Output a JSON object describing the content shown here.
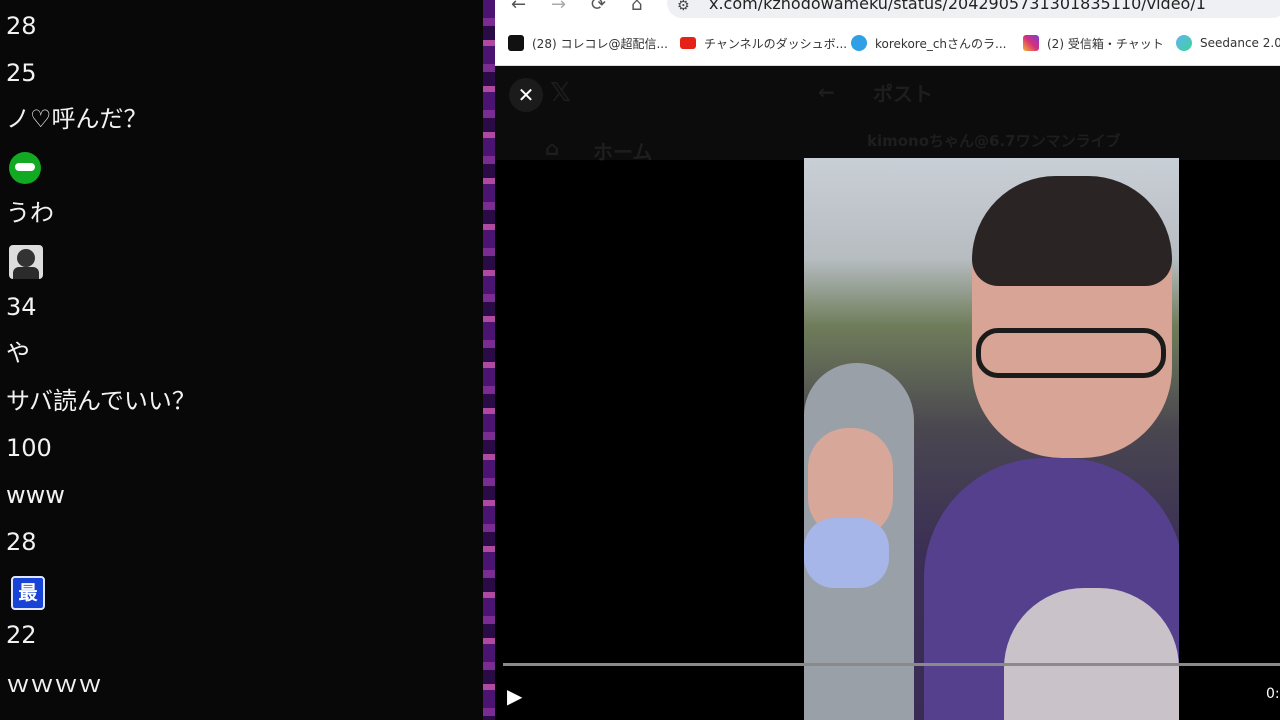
{
  "comments": {
    "items": [
      {
        "kind": "text",
        "text": "28"
      },
      {
        "kind": "text",
        "text": "25"
      },
      {
        "kind": "text",
        "text": "ノ♡呼んだ？"
      },
      {
        "kind": "stamp",
        "icon": "green-emoji-stamp"
      },
      {
        "kind": "text",
        "text": "うわ"
      },
      {
        "kind": "stamp",
        "icon": "avatar-stamp"
      },
      {
        "kind": "text",
        "text": "34"
      },
      {
        "kind": "text",
        "text": "や"
      },
      {
        "kind": "text",
        "text": "サバ読んでいい？"
      },
      {
        "kind": "text",
        "text": "100"
      },
      {
        "kind": "text",
        "text": "www"
      },
      {
        "kind": "text",
        "text": "28"
      },
      {
        "kind": "stamp",
        "icon": "blue-kanji-stamp",
        "text": "最"
      },
      {
        "kind": "text",
        "text": "22"
      },
      {
        "kind": "text",
        "text": "ｗｗｗｗ"
      }
    ]
  },
  "browser": {
    "url": "x.com/kzhodowameku/status/2042905731301835110/video/1",
    "nav": {
      "back": "←",
      "forward": "→",
      "reload": "⟳",
      "home": "⌂"
    },
    "bookmarks": [
      {
        "label": "(28) コレコレ@超配信...",
        "icon": "x-icon",
        "color": "#111111"
      },
      {
        "label": "チャンネルのダッシュボ...",
        "icon": "youtube-icon",
        "color": "#e62117"
      },
      {
        "label": "korekore_chさんのラ...",
        "icon": "twitcasting-icon",
        "color": "#2fa0e6"
      },
      {
        "label": "(2) 受信箱・チャット",
        "icon": "instagram-icon",
        "color": "#d6307a"
      },
      {
        "label": "Seedance 2.0",
        "icon": "seedance-icon",
        "color": "#5fb3f0"
      }
    ]
  },
  "viewer": {
    "close_label": "✕",
    "bg_post_title": "ポスト",
    "bg_home": "ホーム",
    "bg_user": "kimonoちゃん@6.7ワンマンライブ",
    "play_label": "▶",
    "time_label": "0:",
    "progress": 0.0
  }
}
